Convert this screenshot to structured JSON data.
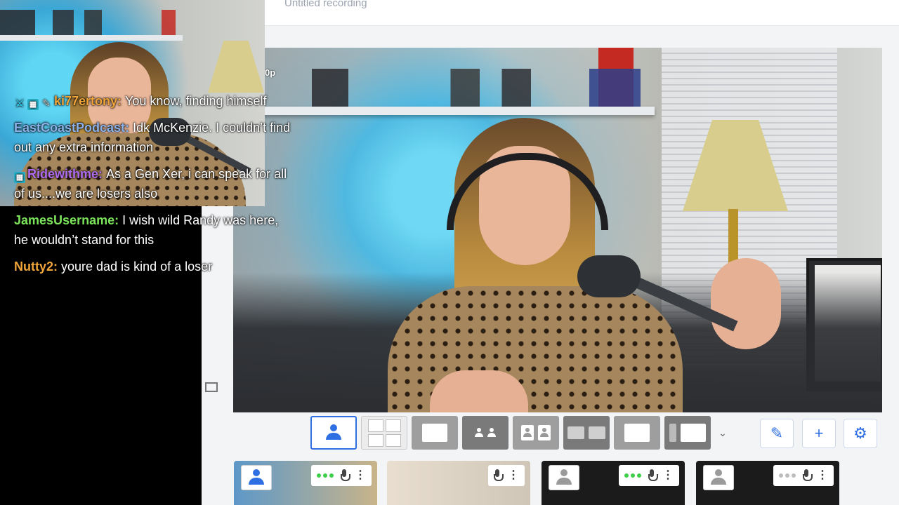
{
  "studio": {
    "recording_title": "Untitled recording"
  },
  "stage": {
    "overlay_label": "0p"
  },
  "chat": {
    "messages": [
      {
        "badges": [
          "sword-badge",
          "grid-badge",
          "pen-badge"
        ],
        "username": "ki77ertony",
        "username_color": "#f0a53a",
        "text": "You know, finding himself"
      },
      {
        "badges": [],
        "username": "EastCoastPodcast",
        "username_color": "#8bb2e8",
        "text": "Idk McKenzie. I couldn’t find out any extra information"
      },
      {
        "badges": [
          "grid-badge"
        ],
        "username": "Ridewithme",
        "username_color": "#b06cf0",
        "text": "As a Gen Xer, i can speak for all of us....we are losers also"
      },
      {
        "badges": [],
        "username": "JamesUsername",
        "username_color": "#7be35a",
        "text": "I wish wild Randy was here, he wouldn’t stand for this"
      },
      {
        "badges": [],
        "username": "Nutty2",
        "username_color": "#f0a53a",
        "text": "youre dad is kind of a loser"
      }
    ]
  },
  "layouts": [
    {
      "name": "layout-solo",
      "active": true
    },
    {
      "name": "layout-grid-four",
      "active": false
    },
    {
      "name": "layout-screen-presenter",
      "active": false
    },
    {
      "name": "layout-group",
      "active": false
    },
    {
      "name": "layout-side-by-side",
      "active": false
    },
    {
      "name": "layout-split",
      "active": false
    },
    {
      "name": "layout-screen",
      "active": false
    },
    {
      "name": "layout-sidebar-screen",
      "active": false
    }
  ],
  "tools": [
    "pencil-icon",
    "plus-icon",
    "gear-icon"
  ],
  "colors": {
    "accent": "#2f6fe4",
    "audio_active": "#3ecf4a"
  }
}
